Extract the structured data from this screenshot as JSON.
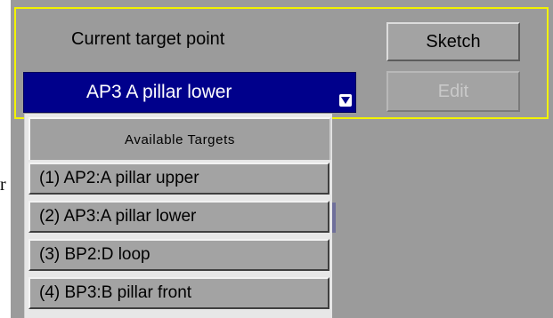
{
  "stray": {
    "text": "r"
  },
  "target": {
    "label": "Current target point",
    "selected": "AP3  A pillar lower",
    "arrow_icon": "dropdown-arrow-icon"
  },
  "buttons": {
    "sketch": "Sketch",
    "edit": "Edit"
  },
  "popup": {
    "header": "Available Targets",
    "items": [
      {
        "label": "(1) AP2:A pillar upper"
      },
      {
        "label": "(2) AP3:A pillar lower"
      },
      {
        "label": "(3) BP2:D loop"
      },
      {
        "label": "(4) BP3:B pillar front"
      }
    ]
  },
  "colors": {
    "panel_bg": "#9b9b9b",
    "selected_bg": "#00008b",
    "highlight_outline": "#f2f200",
    "popup_bg": "#e7e7e7"
  }
}
